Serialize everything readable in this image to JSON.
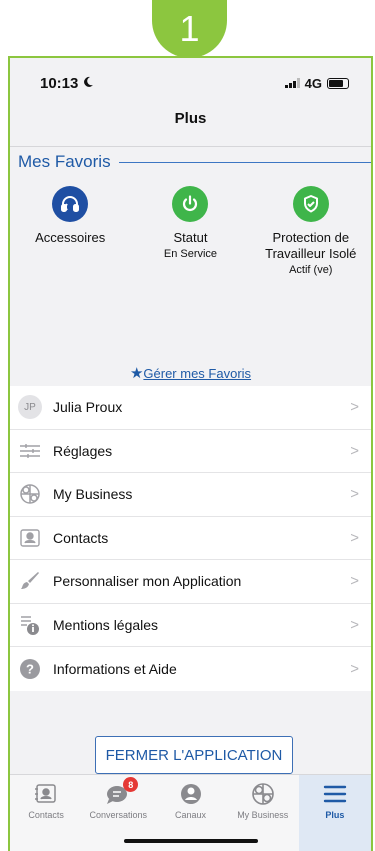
{
  "step_badge": "1",
  "status_bar": {
    "time": "10:13",
    "network": "4G"
  },
  "nav": {
    "title": "Plus"
  },
  "favorites": {
    "header": "Mes Favoris",
    "items": [
      {
        "name": "Accessoires",
        "subtitle": "",
        "icon": "headset-icon",
        "color": "#1f4fa3"
      },
      {
        "name": "Statut",
        "subtitle": "En Service",
        "icon": "power-icon",
        "color": "#3fb54a"
      },
      {
        "name": "Protection de Travailleur Isolé",
        "subtitle": "Actif (ve)",
        "icon": "shield-check-icon",
        "color": "#3fb54a"
      }
    ],
    "manage_link": "Gérer mes Favoris"
  },
  "menu": {
    "items": [
      {
        "label": "Julia Proux",
        "icon": "avatar-initials",
        "initials": "JP"
      },
      {
        "label": "Réglages",
        "icon": "sliders-icon"
      },
      {
        "label": "My Business",
        "icon": "business-logo-icon"
      },
      {
        "label": "Contacts",
        "icon": "contact-card-icon"
      },
      {
        "label": "Personnaliser mon Application",
        "icon": "brush-icon"
      },
      {
        "label": "Mentions légales",
        "icon": "legal-info-icon"
      },
      {
        "label": "Informations et Aide",
        "icon": "help-icon"
      }
    ]
  },
  "close_button": "FERMER L'APPLICATION",
  "tabbar": {
    "tabs": [
      {
        "label": "Contacts",
        "icon": "contact-card-icon",
        "active": false
      },
      {
        "label": "Conversations",
        "icon": "chat-icon",
        "active": false,
        "badge": "8"
      },
      {
        "label": "Canaux",
        "icon": "channels-icon",
        "active": false
      },
      {
        "label": "My Business",
        "icon": "business-logo-icon",
        "active": false
      },
      {
        "label": "Plus",
        "icon": "hamburger-icon",
        "active": true
      }
    ]
  },
  "colors": {
    "accent": "#1f5aa6",
    "frame_green": "#8cc63f",
    "badge_red": "#e53935"
  }
}
